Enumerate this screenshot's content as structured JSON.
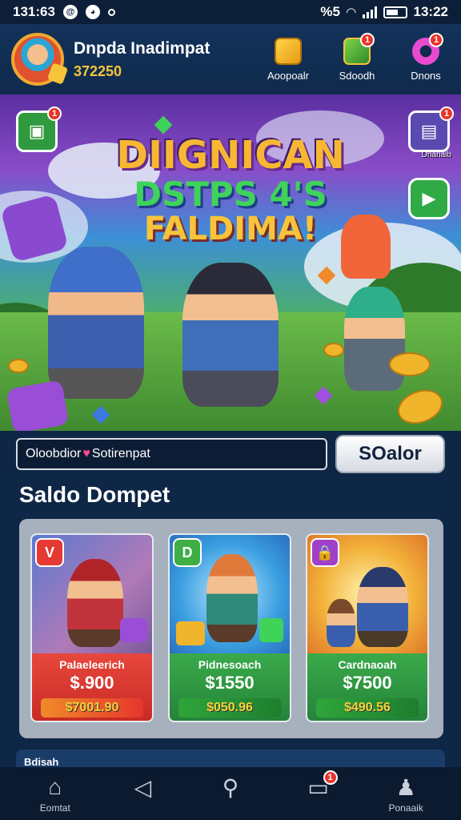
{
  "status_bar": {
    "time_left": "131:63",
    "time_right": "13:22",
    "signal_label": "%5"
  },
  "header": {
    "username": "Dnpda Inadimpat",
    "coins": "372250",
    "buttons": [
      {
        "label": "Aoopoalr",
        "icon": "gift-box-icon",
        "badge": ""
      },
      {
        "label": "Sdoodh",
        "icon": "chest-icon",
        "badge": "1"
      },
      {
        "label": "Dnons",
        "icon": "gear-icon",
        "badge": "1"
      }
    ]
  },
  "banner": {
    "title_line1": "DIIGNICAN",
    "title_line2": "DSTPS 4'S",
    "title_line3": "FALDIMA!",
    "left_badge": "1",
    "right_badge": "1",
    "right_label": "Dnanaib",
    "colors": {
      "title_gold": "#f7b733",
      "title_green": "#3fd35a"
    }
  },
  "search": {
    "value_part1": "Oloobdior",
    "value_part2": "Sotirenpat",
    "button_label": "SOalor"
  },
  "section_title": "Saldo Dompet",
  "cards": [
    {
      "tag": "V",
      "name": "Palaeleerich",
      "price": "$.900",
      "cta": "$7001.90",
      "color": "#e53a33"
    },
    {
      "tag": "D",
      "name": "Pidnesoach",
      "price": "$1550",
      "cta": "$050.96",
      "color": "#2e9a3e"
    },
    {
      "tag": "🔒",
      "name": "Cardnaoah",
      "price": "$7500",
      "cta": "$490.56",
      "color": "#2e9a3e"
    }
  ],
  "strip_label": "Bdisah",
  "nav": [
    {
      "label": "Eomtat",
      "icon": "home-icon",
      "badge": ""
    },
    {
      "label": "",
      "icon": "back-triangle-icon",
      "badge": ""
    },
    {
      "label": "",
      "icon": "search-icon",
      "badge": ""
    },
    {
      "label": "",
      "icon": "chat-icon",
      "badge": "1"
    },
    {
      "label": "Ponaaik",
      "icon": "profile-icon",
      "badge": ""
    }
  ]
}
